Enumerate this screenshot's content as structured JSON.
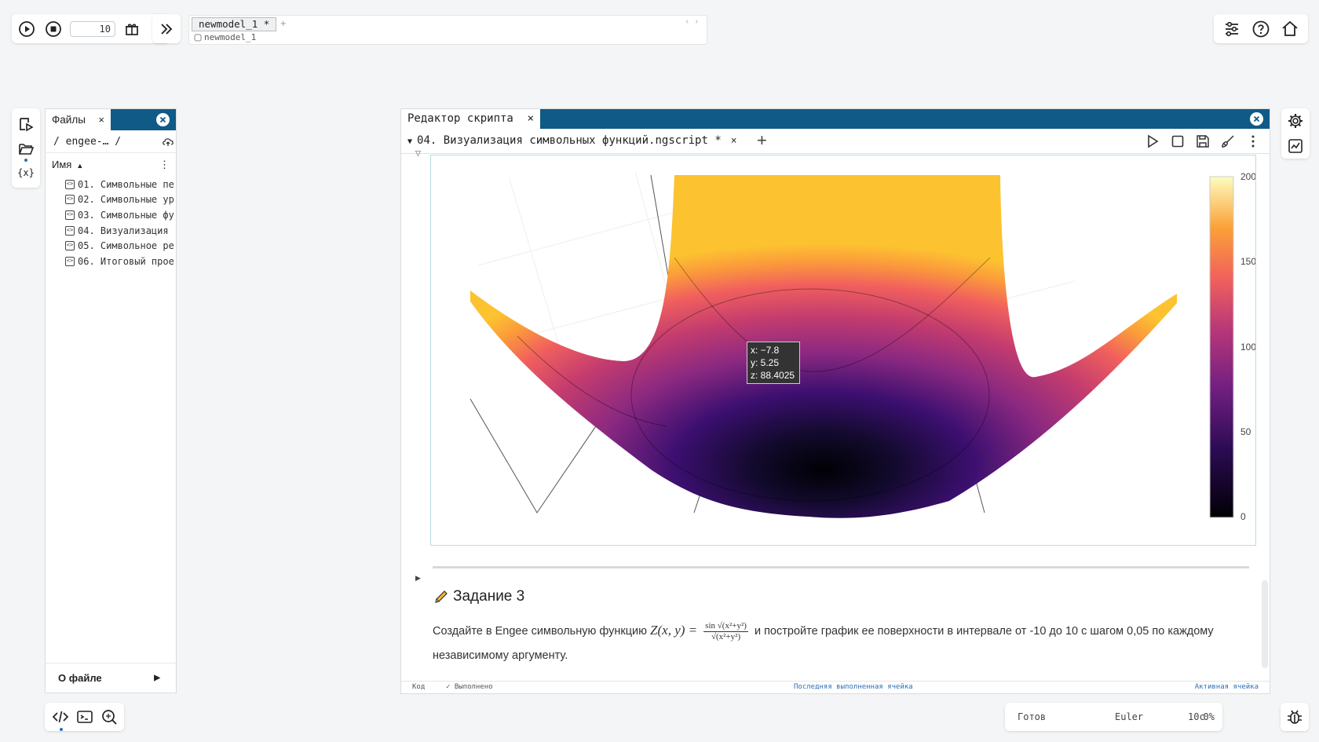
{
  "toolbar": {
    "steps_value": "10"
  },
  "model": {
    "tab_label": "newmodel_1 *",
    "add_label": "+",
    "nav_arrows": "‹ ›",
    "breadcrumb": "newmodel_1"
  },
  "files": {
    "tab_label": "Файлы",
    "close_label": "×",
    "path": "/  engee-…  /",
    "column_name": "Имя",
    "sort_indicator": "▲",
    "menu": "⋮",
    "items": [
      {
        "label": "01. Символьные пе"
      },
      {
        "label": "02. Символьные ур"
      },
      {
        "label": "03. Символьные фу"
      },
      {
        "label": "04. Визуализация "
      },
      {
        "label": "05. Символьное ре"
      },
      {
        "label": "06. Итоговый прое"
      }
    ],
    "footer": "О файле",
    "footer_arrow": "▶"
  },
  "editor": {
    "title": "Редактор скрипта",
    "close_label": "×",
    "tab_label": "04. Визуализация символьных функций.ngscript *",
    "tab_collapse": "▼",
    "add_tab": "+",
    "cell_caret": "▽",
    "tooltip": {
      "x": "x: −7.8",
      "y": "y: 5.25",
      "z": "z: 88.4025"
    },
    "colorbar": {
      "labels": [
        "200",
        "150",
        "100",
        "50",
        "0"
      ],
      "axis_tick": "0"
    },
    "md_caret": "▶",
    "task_title": "Задание 3",
    "task_text_before": "Создайте в Engee символьную функцию",
    "task_formula_lhs": "Z(x, y) =",
    "task_formula_num": "sin √(x²+y²)",
    "task_formula_den": "√(x²+y²)",
    "task_text_after": "и постройте график ее поверхности в интервале от -10 до 10 с шагом 0,05 по каждому независимому аргументу.",
    "status_code": "Код",
    "status_done": "✓ Выполнено",
    "status_last": "Последняя выполненная ячейка",
    "status_active": "Активная ячейка"
  },
  "status": {
    "state": "Готов",
    "solver": "Euler",
    "time": "10с",
    "progress": "0%"
  },
  "colors": {
    "header_blue": "#0f5a86",
    "accent_blue": "#2f6fb3"
  }
}
